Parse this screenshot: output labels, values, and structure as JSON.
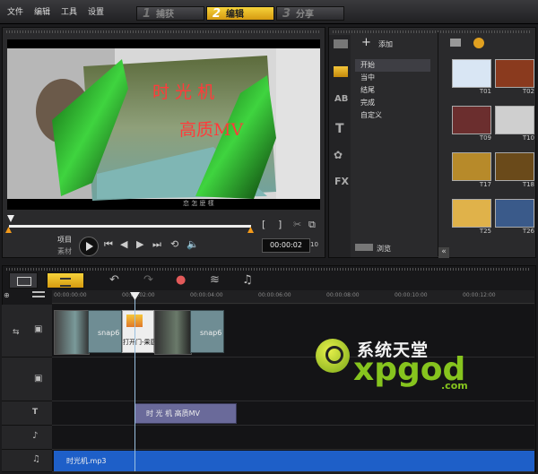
{
  "menu": {
    "file": "文件",
    "edit": "编辑",
    "tools": "工具",
    "settings": "设置"
  },
  "steps": [
    {
      "num": "1",
      "label": "捕获"
    },
    {
      "num": "2",
      "label": "编辑"
    },
    {
      "num": "3",
      "label": "分享"
    }
  ],
  "preview": {
    "overlay_line1": "时 光 机",
    "overlay_line2": "高质MV",
    "caption": "恋 怎 麽 樣",
    "mode_project": "项目",
    "mode_clip": "素材",
    "timecode": "00:00:02",
    "timecode_suffix": "10",
    "bracket_in": "[",
    "bracket_out": "]"
  },
  "library": {
    "add_label": "添加",
    "categories": [
      "开始",
      "当中",
      "结尾",
      "完成",
      "自定义"
    ],
    "selected_category": "开始",
    "browse_label": "浏览",
    "fx_label": "FX",
    "thumbnails": [
      {
        "label": "T01",
        "color": "#d9e6f4"
      },
      {
        "label": "T02",
        "color": "#8a3a1e"
      },
      {
        "label": "T09",
        "color": "#6b2e2e"
      },
      {
        "label": "T10",
        "color": "#cfcfcf"
      },
      {
        "label": "T17",
        "color": "#b78a2a"
      },
      {
        "label": "T18",
        "color": "#6a4a1a"
      },
      {
        "label": "T25",
        "color": "#e0b24a"
      },
      {
        "label": "T26",
        "color": "#3a5a8a"
      }
    ]
  },
  "timeline": {
    "ticks": [
      "00:00:00:00",
      "00:00:02:00",
      "00:00:04:00",
      "00:00:06:00",
      "00:00:08:00",
      "00:00:10:00",
      "00:00:12:00"
    ],
    "video_clip_1": "snap6",
    "video_clip_2": "snap6",
    "transition_clip": "打开门-果厨",
    "title_clip": "时 光 机  高质MV",
    "audio_clip": "时光机.mp3"
  },
  "watermark": {
    "line1": "系统天堂",
    "line2": "xpgod",
    "line3": ".com"
  },
  "colors": {
    "accent": "#f2c232",
    "audio": "#1e5fc8",
    "title_clip": "#6a6a9a"
  }
}
